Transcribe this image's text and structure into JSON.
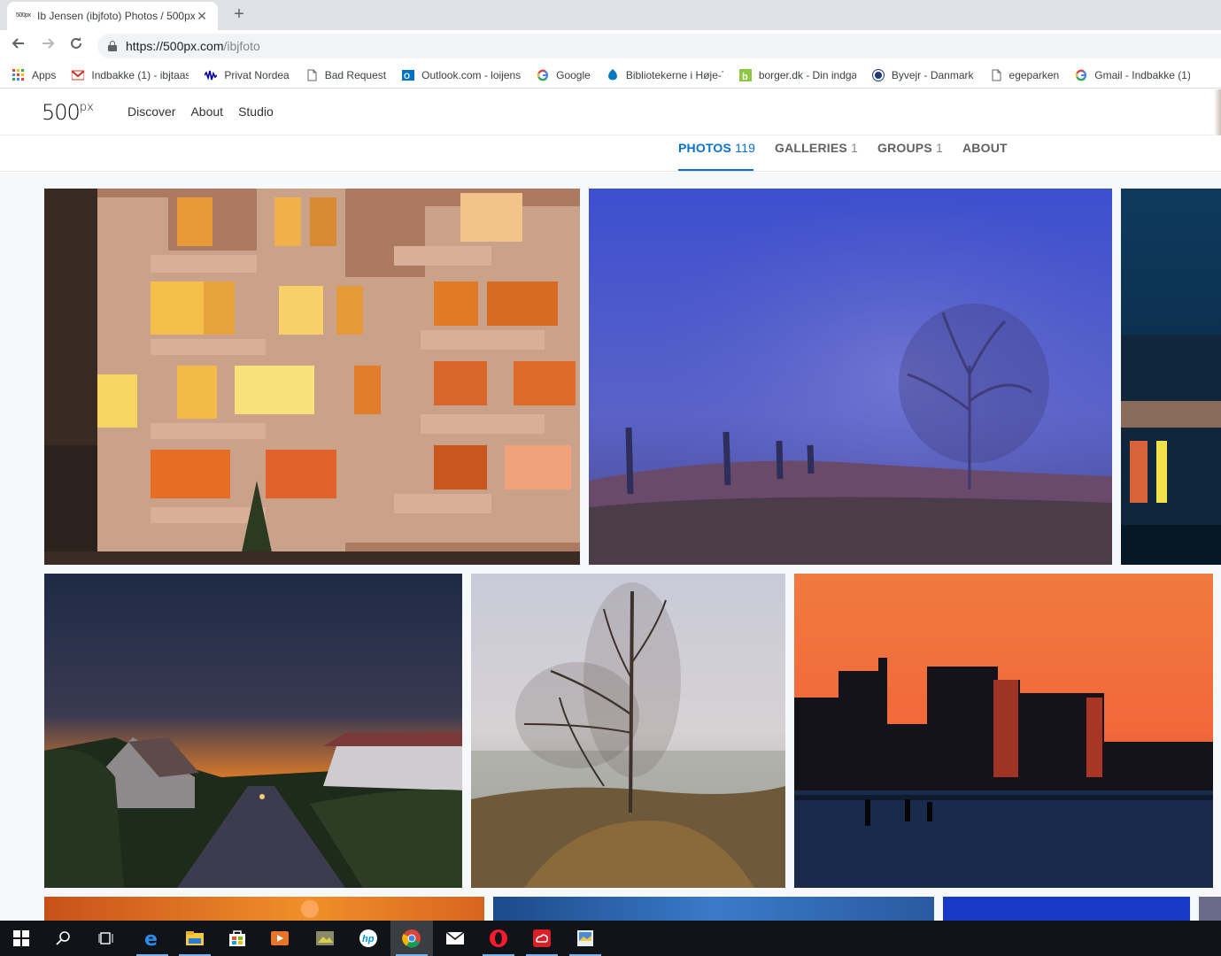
{
  "browser": {
    "tab_title": "Ib Jensen (ibjfoto) Photos / 500px",
    "tab_favicon_text": "500px",
    "url_host": "https://500px.com",
    "url_path": "/ibjfoto"
  },
  "bookmarks": [
    {
      "label": "Apps",
      "icon": "apps-grid-icon"
    },
    {
      "label": "Indbakke (1) - ibjtaas",
      "icon": "gmail-icon"
    },
    {
      "label": "Privat  Nordea",
      "icon": "nordea-icon"
    },
    {
      "label": "Bad Request",
      "icon": "page-icon"
    },
    {
      "label": "Outlook.com - loijens",
      "icon": "outlook-icon"
    },
    {
      "label": "Google",
      "icon": "google-icon"
    },
    {
      "label": "Bibliotekerne i Høje-T",
      "icon": "drupal-icon"
    },
    {
      "label": "borger.dk - Din indga",
      "icon": "borger-icon"
    },
    {
      "label": "Byvejr - Danmark",
      "icon": "dmi-icon"
    },
    {
      "label": "egeparken",
      "icon": "page-icon"
    },
    {
      "label": "Gmail - Indbakke (1)",
      "icon": "google-icon"
    }
  ],
  "site": {
    "logo": "500",
    "logo_sup": "px",
    "nav": [
      "Discover",
      "About",
      "Studio"
    ]
  },
  "profile_tabs": [
    {
      "label": "PHOTOS",
      "count": "119",
      "active": true
    },
    {
      "label": "GALLERIES",
      "count": "1",
      "active": false
    },
    {
      "label": "GROUPS",
      "count": "1",
      "active": false
    },
    {
      "label": "ABOUT",
      "count": "",
      "active": false
    }
  ],
  "taskbar": [
    "windows-start-icon",
    "search-icon",
    "task-view-icon",
    "edge-icon",
    "file-explorer-icon",
    "store-icon",
    "media-player-icon",
    "photo-app-icon",
    "hp-icon",
    "chrome-icon",
    "mail-icon",
    "opera-icon",
    "creative-cloud-icon",
    "photos-icon"
  ]
}
